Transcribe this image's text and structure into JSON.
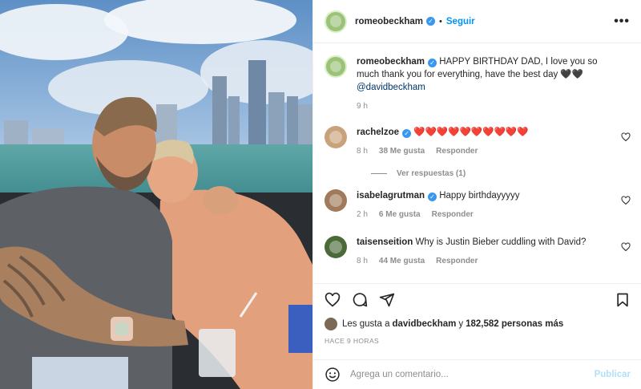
{
  "post": {
    "author": "romeobeckham",
    "follow_label": "Seguir",
    "more_label": "•••",
    "dot": "•"
  },
  "caption": {
    "author": "romeobeckham",
    "text": "HAPPY BIRTHDAY DAD, I love you so much thank you for everything, have the best day 🖤🖤",
    "mention": "@davidbeckham",
    "time": "9 h"
  },
  "comments": [
    {
      "user": "rachelzoe",
      "verified": true,
      "text": "❤️❤️❤️❤️❤️❤️❤️❤️❤️❤️",
      "time": "8 h",
      "likes": "38 Me gusta",
      "reply": "Responder",
      "view_replies": "Ver respuestas (1)",
      "avatar_color": "#c8a27a"
    },
    {
      "user": "isabelagrutman",
      "verified": true,
      "text": "Happy birthdayyyyy",
      "time": "2 h",
      "likes": "6 Me gusta",
      "reply": "Responder",
      "avatar_color": "#a07a5a"
    },
    {
      "user": "taisenseition",
      "verified": false,
      "text": "Why is Justin Bieber cuddling with David?",
      "time": "8 h",
      "likes": "44 Me gusta",
      "reply": "Responder",
      "avatar_color": "#4a6a3a"
    }
  ],
  "likes": {
    "prefix": "Les gusta a",
    "user": "davidbeckham",
    "connector": "y",
    "count": "182,582 personas más"
  },
  "posted_ago": "HACE 9 HORAS",
  "add_comment": {
    "placeholder": "Agrega un comentario...",
    "publish_label": "Publicar"
  },
  "colors": {
    "accent": "#0095f6",
    "verified": "#3897f0",
    "muted": "#8e8e8e"
  },
  "icons": [
    "heart-icon",
    "comment-icon",
    "share-icon",
    "bookmark-icon",
    "emoji-icon",
    "verified-icon",
    "more-icon"
  ]
}
